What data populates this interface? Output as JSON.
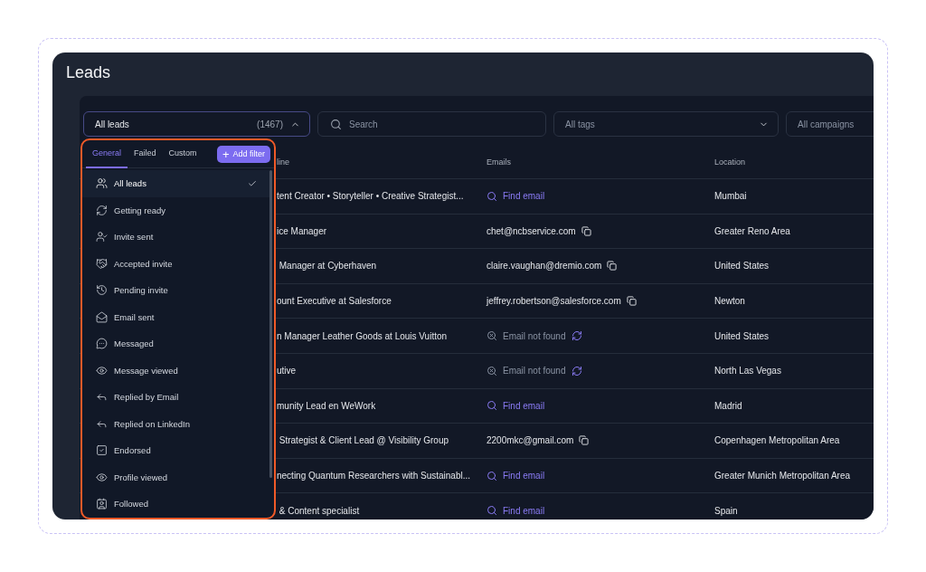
{
  "page": {
    "title": "Leads"
  },
  "filters": {
    "list_select": {
      "value": "All leads",
      "count": "(1467)",
      "expanded": true
    },
    "search": {
      "placeholder": "Search"
    },
    "tags_select": {
      "value": "All tags"
    },
    "campaigns_select": {
      "value": "All campaigns"
    }
  },
  "list_menu": {
    "tabs": [
      {
        "label": "General",
        "selected": true
      },
      {
        "label": "Failed",
        "selected": false
      },
      {
        "label": "Custom",
        "selected": false
      }
    ],
    "add_button": {
      "icon": "+",
      "label": "Add filter"
    },
    "items": [
      {
        "label": "All leads",
        "selected": true
      },
      {
        "label": "Getting ready",
        "selected": false
      },
      {
        "label": "Invite sent",
        "selected": false
      },
      {
        "label": "Accepted invite",
        "selected": false
      },
      {
        "label": "Pending invite",
        "selected": false
      },
      {
        "label": "Email sent",
        "selected": false
      },
      {
        "label": "Messaged",
        "selected": false
      },
      {
        "label": "Message viewed",
        "selected": false
      },
      {
        "label": "Replied by Email",
        "selected": false
      },
      {
        "label": "Replied on LinkedIn",
        "selected": false
      },
      {
        "label": "Endorsed",
        "selected": false
      },
      {
        "label": "Profile viewed",
        "selected": false
      },
      {
        "label": "Followed",
        "selected": false
      }
    ]
  },
  "table": {
    "columns": [
      "line",
      "Emails",
      "Location"
    ],
    "rows": [
      {
        "column_1": "tent Creator • Storyteller • Creative Strategist...",
        "email": {
          "kind": "find",
          "text": "Find email"
        },
        "location": "Mumbai"
      },
      {
        "column_1": "ice Manager",
        "email": {
          "kind": "found",
          "text": "chet@ncbservice.com"
        },
        "location": "Greater Reno Area"
      },
      {
        "column_1": " Manager at Cyberhaven",
        "email": {
          "kind": "found",
          "text": "claire.vaughan@dremio.com"
        },
        "location": "United States"
      },
      {
        "column_1": "ount Executive at Salesforce",
        "email": {
          "kind": "found",
          "text": "jeffrey.robertson@salesforce.com"
        },
        "location": "Newton"
      },
      {
        "column_1": "n Manager Leather Goods at Louis Vuitton",
        "email": {
          "kind": "not_found",
          "text": "Email not found"
        },
        "location": "United States"
      },
      {
        "column_1": "utive",
        "email": {
          "kind": "not_found",
          "text": "Email not found"
        },
        "location": "North Las Vegas"
      },
      {
        "column_1": "munity Lead en WeWork",
        "email": {
          "kind": "find",
          "text": "Find email"
        },
        "location": "Madrid"
      },
      {
        "column_1": " Strategist & Client Lead @ Visibility Group",
        "email": {
          "kind": "found",
          "text": "2200mkc@gmail.com"
        },
        "location": "Copenhagen Metropolitan Area"
      },
      {
        "column_1": "necting Quantum Researchers with Sustainabl...",
        "email": {
          "kind": "find",
          "text": "Find email"
        },
        "location": "Greater Munich Metropolitan Area"
      },
      {
        "column_1": " & Content specialist",
        "email": {
          "kind": "find",
          "text": "Find email"
        },
        "location": "Spain"
      }
    ]
  }
}
